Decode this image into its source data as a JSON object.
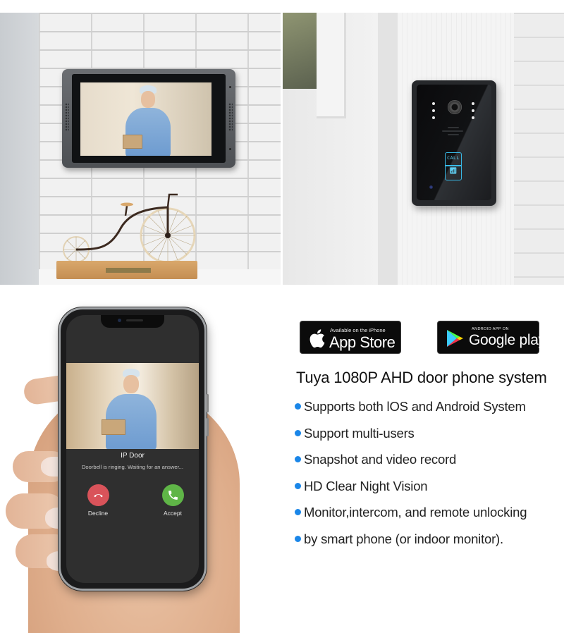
{
  "scenes": {
    "indoor_monitor": {
      "subject": "indoor video monitor on white brick wall",
      "decor": "penny-farthing bicycle ornament"
    },
    "door_station": {
      "subject": "outdoor doorbell camera station",
      "call_button_label": "CALL",
      "rfid_icon": "wifi-rfid-icon"
    },
    "phone": {
      "call_screen": {
        "title": "IP Door",
        "status": "Doorbell is ringing. Waiting for an answer...",
        "decline_label": "Decline",
        "accept_label": "Accept",
        "decline_icon": "phone-hangup-icon",
        "accept_icon": "phone-answer-icon"
      }
    }
  },
  "store_badges": {
    "app_store": {
      "small_text": "Available on the iPhone",
      "big_text": "App Store",
      "icon": "apple-icon"
    },
    "google_play": {
      "small_text": "ANDROID APP ON",
      "big_text": "Google play",
      "icon": "play-triangle-icon"
    }
  },
  "product": {
    "title": "Tuya 1080P AHD door phone system",
    "features": [
      "Supports both lOS and Android System",
      "Support multi-users",
      "Snapshot and video record",
      "HD Clear Night Vision",
      "Monitor,intercom, and remote unlocking",
      "by smart phone (or indoor monitor)."
    ]
  },
  "colors": {
    "bullet": "#1a86e8",
    "decline": "#d9535a",
    "accept": "#5fb547",
    "call_button_glow": "#38b9e6"
  }
}
